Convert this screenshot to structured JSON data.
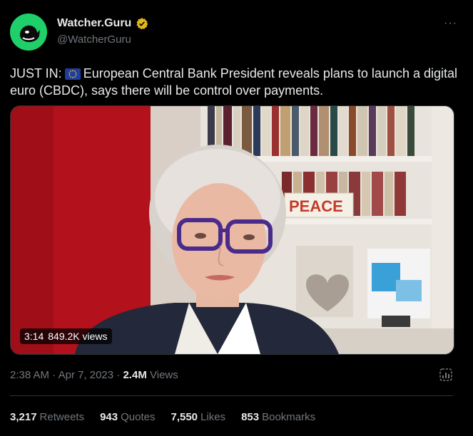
{
  "author": {
    "name": "Watcher.Guru",
    "handle": "@WatcherGuru",
    "more_label": "···"
  },
  "tweet": {
    "prefix": "JUST IN:",
    "flag_icon": "eu-flag-icon",
    "body": "European Central Bank President reveals plans to launch a digital euro (CBDC), says there will be control over payments."
  },
  "video": {
    "duration": "3:14",
    "views": "849.2K views",
    "poster_text": "PEACE"
  },
  "meta": {
    "time": "2:38 AM",
    "separator1": "·",
    "date": "Apr 7, 2023",
    "separator2": "·",
    "views_count": "2.4M",
    "views_label": "Views"
  },
  "stats": [
    {
      "count": "3,217",
      "label": "Retweets"
    },
    {
      "count": "943",
      "label": "Quotes"
    },
    {
      "count": "7,550",
      "label": "Likes"
    },
    {
      "count": "853",
      "label": "Bookmarks"
    }
  ],
  "colors": {
    "background": "#000000",
    "text": "#e7e9ea",
    "secondary": "#71767b",
    "brand": "#1ecf6a",
    "verified": "#e2b719"
  }
}
